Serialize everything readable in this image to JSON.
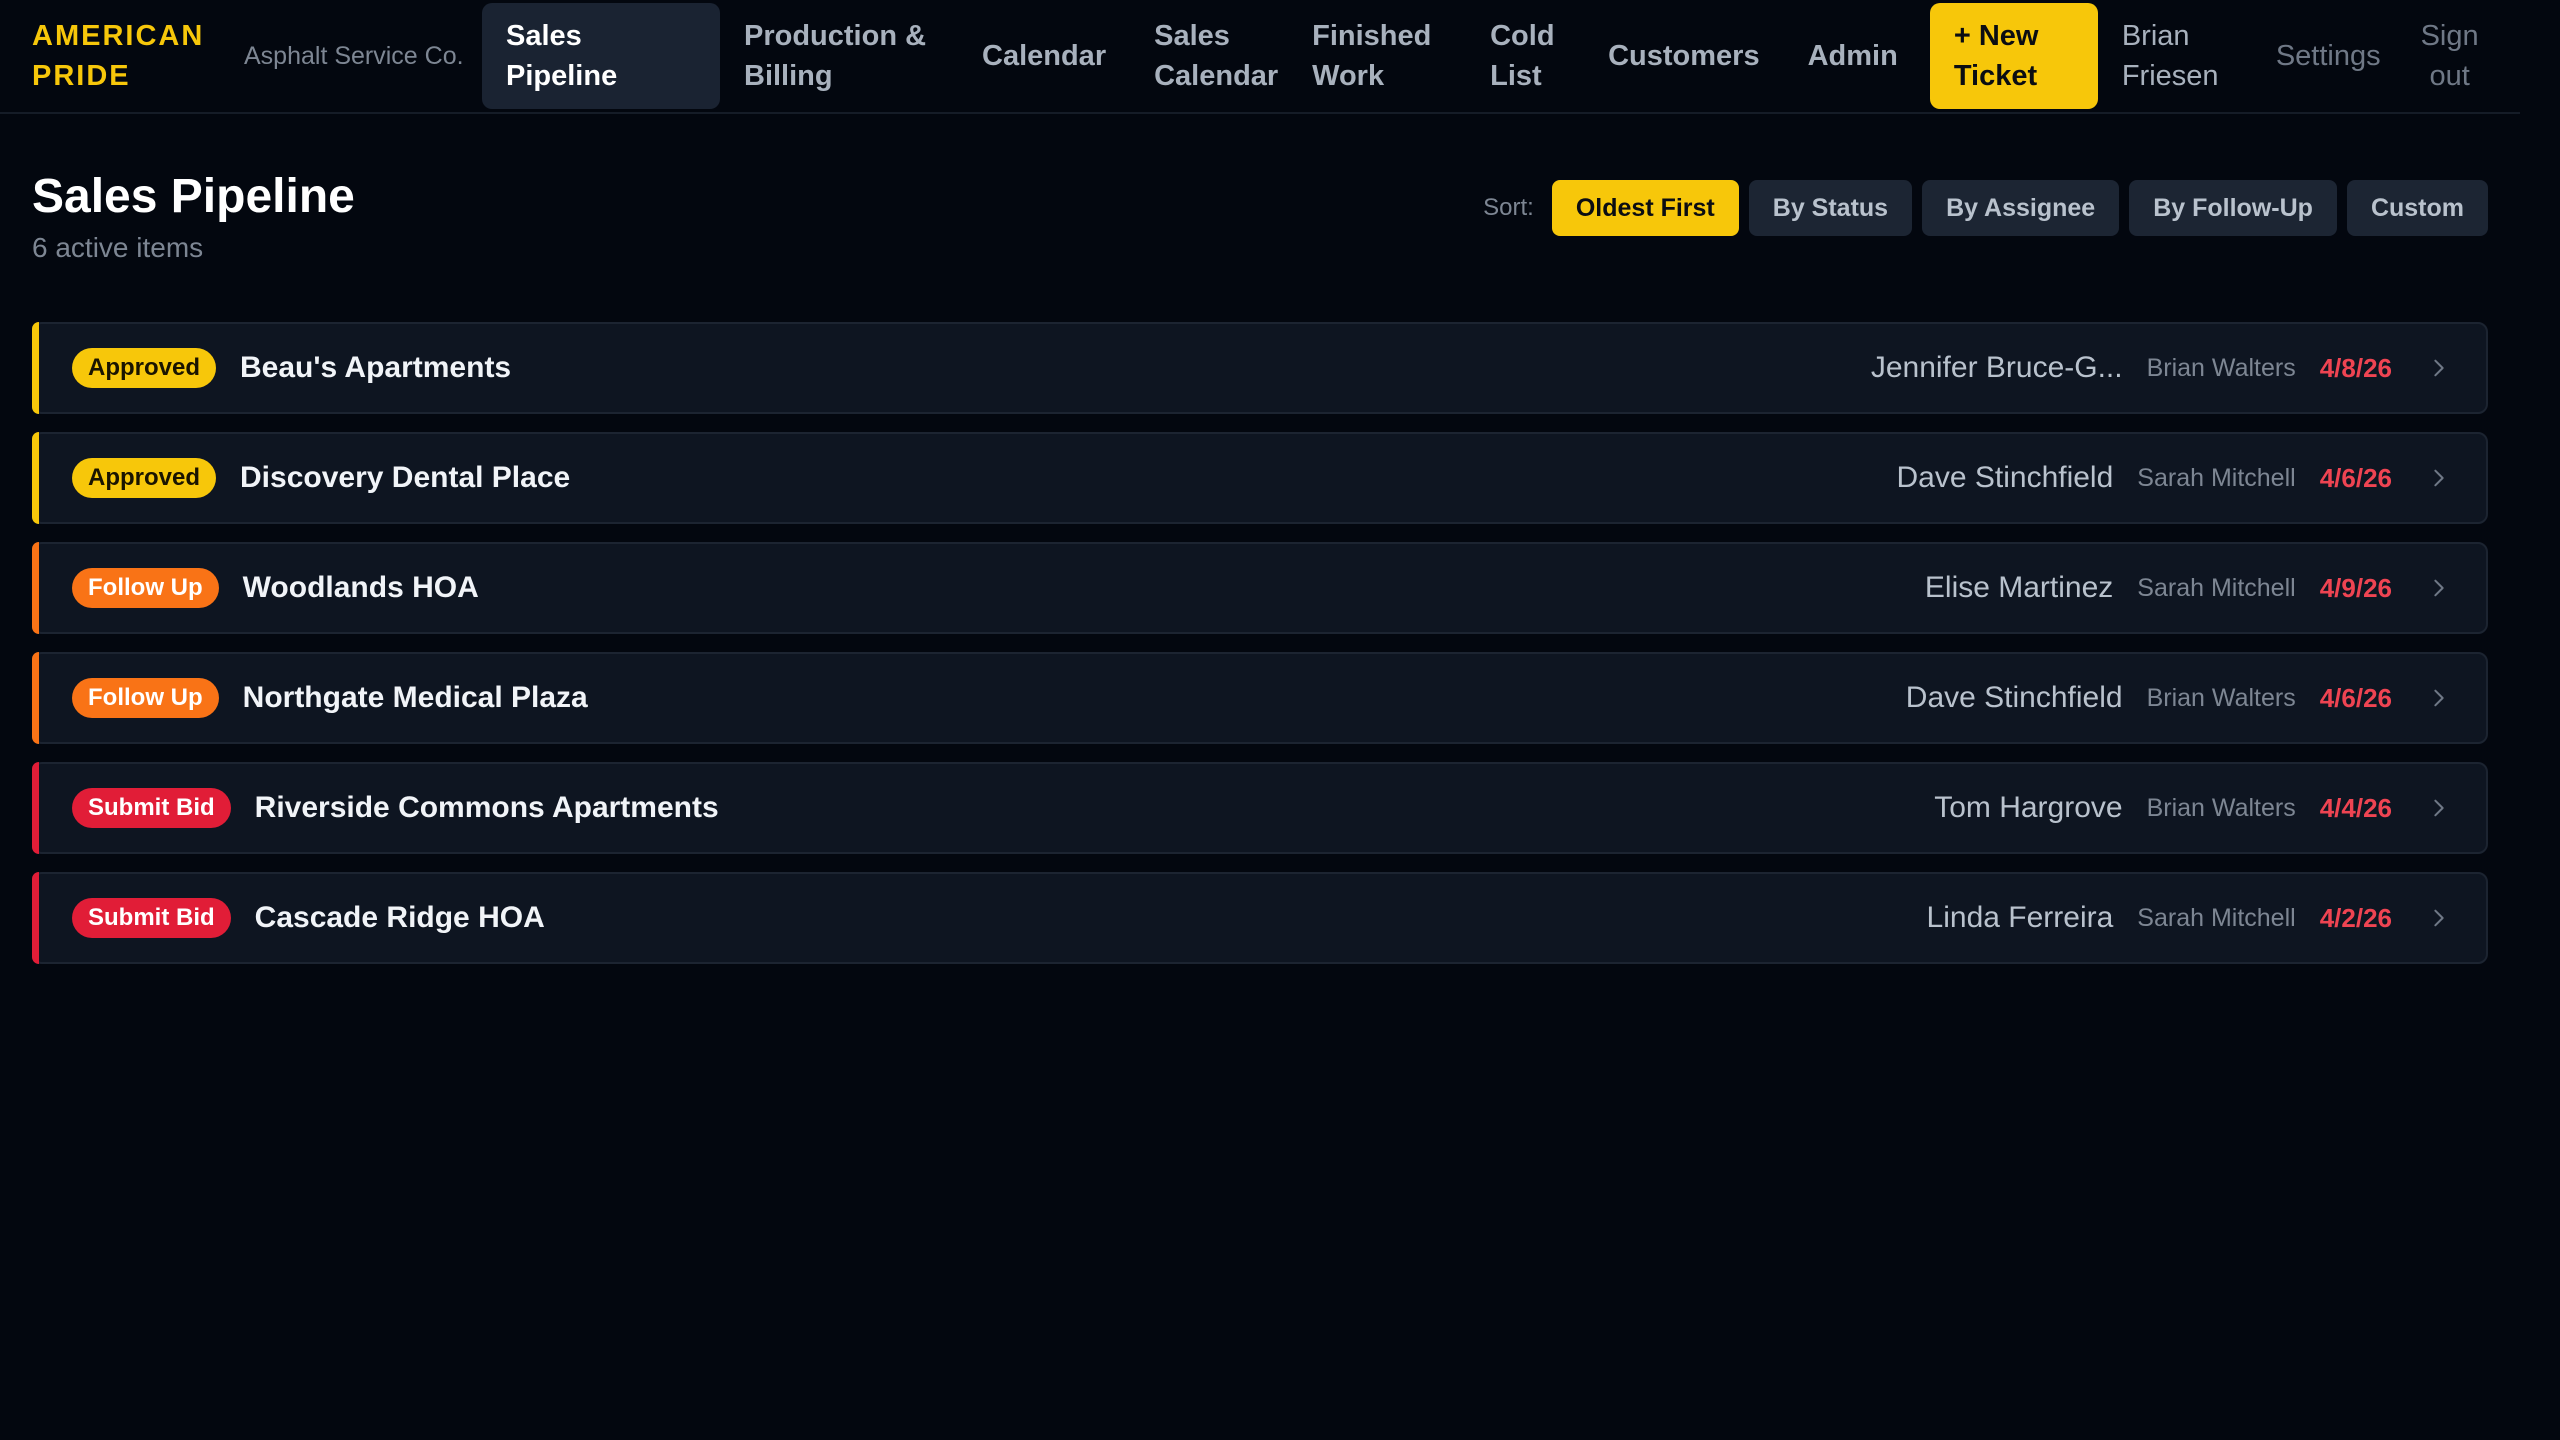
{
  "nav": {
    "brand": "AMERICAN PRIDE",
    "company": "Asphalt Service Co.",
    "items": [
      {
        "label": "Sales Pipeline",
        "active": true
      },
      {
        "label": "Production & Billing",
        "active": false
      },
      {
        "label": "Calendar",
        "active": false
      },
      {
        "label": "Sales Calendar",
        "active": false
      },
      {
        "label": "Finished Work",
        "active": false
      },
      {
        "label": "Cold List",
        "active": false
      },
      {
        "label": "Customers",
        "active": false
      },
      {
        "label": "Admin",
        "active": false
      }
    ],
    "new_ticket": "+ New Ticket",
    "user": "Brian Friesen",
    "settings": "Settings",
    "signout": "Sign out"
  },
  "header": {
    "title": "Sales Pipeline",
    "subtitle": "6 active items"
  },
  "sort": {
    "label": "Sort:",
    "options": [
      {
        "label": "Oldest First",
        "active": true
      },
      {
        "label": "By Status",
        "active": false
      },
      {
        "label": "By Assignee",
        "active": false
      },
      {
        "label": "By Follow-Up",
        "active": false
      },
      {
        "label": "Custom",
        "active": false
      }
    ]
  },
  "colors": {
    "accent": "#f7c70a",
    "approved": "#f7c70a",
    "follow_up": "#f97316",
    "submit_bid": "#e11d37",
    "date": "#ef4452"
  },
  "rows": [
    {
      "status": "Approved",
      "status_key": "approved",
      "name": "Beau's Apartments",
      "contact": "Jennifer Bruce-G...",
      "assignee": "Brian Walters",
      "date": "4/8/26"
    },
    {
      "status": "Approved",
      "status_key": "approved",
      "name": "Discovery Dental Place",
      "contact": "Dave Stinchfield",
      "assignee": "Sarah Mitchell",
      "date": "4/6/26"
    },
    {
      "status": "Follow Up",
      "status_key": "follow",
      "name": "Woodlands HOA",
      "contact": "Elise Martinez",
      "assignee": "Sarah Mitchell",
      "date": "4/9/26"
    },
    {
      "status": "Follow Up",
      "status_key": "follow",
      "name": "Northgate Medical Plaza",
      "contact": "Dave Stinchfield",
      "assignee": "Brian Walters",
      "date": "4/6/26"
    },
    {
      "status": "Submit Bid",
      "status_key": "submit",
      "name": "Riverside Commons Apartments",
      "contact": "Tom Hargrove",
      "assignee": "Brian Walters",
      "date": "4/4/26"
    },
    {
      "status": "Submit Bid",
      "status_key": "submit",
      "name": "Cascade Ridge HOA",
      "contact": "Linda Ferreira",
      "assignee": "Sarah Mitchell",
      "date": "4/2/26"
    }
  ]
}
